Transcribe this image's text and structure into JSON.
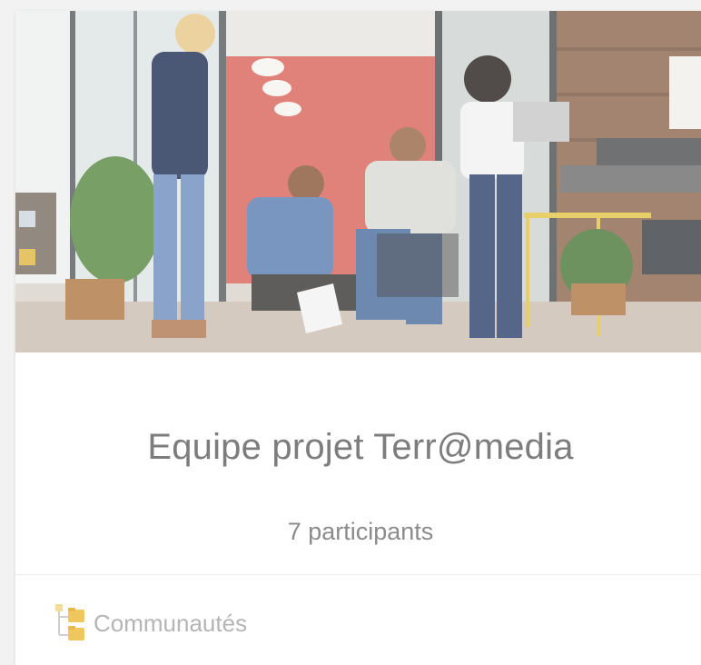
{
  "card": {
    "title": "Equipe projet Terr@media",
    "participants": "7 participants"
  },
  "footer": {
    "icon": "communities-icon",
    "label": "Communautés"
  },
  "colors": {
    "title": "#7d7d7d",
    "meta": "#8b8b8b",
    "footer_text": "#b5b5b5",
    "icon_accent": "#f0c75e"
  }
}
